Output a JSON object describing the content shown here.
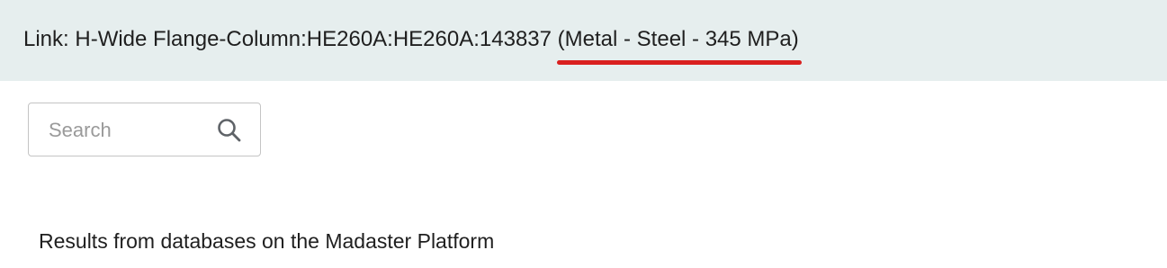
{
  "header": {
    "link_prefix": "Link: H-Wide Flange-Column:HE260A:HE260A:143837 ",
    "material": "(Metal - Steel - 345 MPa)",
    "background_color": "#e6eeee",
    "highlight_color": "#d9201f"
  },
  "search": {
    "placeholder": "Search",
    "value": "",
    "icon": "search-icon"
  },
  "results": {
    "heading": "Results from databases on the Madaster Platform"
  }
}
